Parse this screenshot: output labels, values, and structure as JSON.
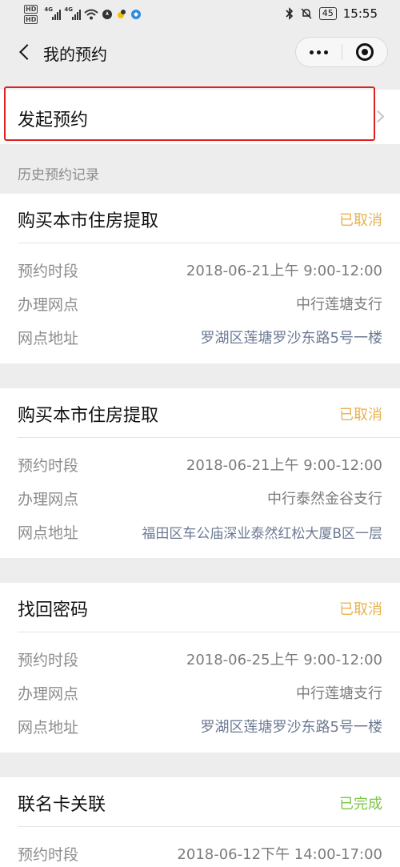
{
  "status_bar": {
    "left_icons": [
      "hd-icon",
      "signal-4g-icon",
      "signal-4g-icon",
      "wifi-icon",
      "compass-icon",
      "bird-icon",
      "app-icon"
    ],
    "hd": "HD",
    "net_1": "4G",
    "net_2": "4G",
    "battery": "45",
    "time": "15:55"
  },
  "nav": {
    "title": "我的预约"
  },
  "launch": {
    "label": "发起预约"
  },
  "history": {
    "header": "历史预约记录"
  },
  "records": [
    {
      "title": "购买本市住房提取",
      "status": "已取消",
      "rows": [
        {
          "label": "预约时段",
          "value": "2018-06-21上午 9:00-12:00"
        },
        {
          "label": "办理网点",
          "value": "中行莲塘支行"
        },
        {
          "label": "网点地址",
          "value": "罗湖区莲塘罗沙东路5号一楼"
        }
      ]
    },
    {
      "title": "购买本市住房提取",
      "status": "已取消",
      "rows": [
        {
          "label": "预约时段",
          "value": "2018-06-21上午 9:00-12:00"
        },
        {
          "label": "办理网点",
          "value": "中行泰然金谷支行"
        },
        {
          "label": "网点地址",
          "value": "福田区车公庙深业泰然红松大厦B区一层"
        }
      ]
    },
    {
      "title": "找回密码",
      "status": "已取消",
      "rows": [
        {
          "label": "预约时段",
          "value": "2018-06-25上午 9:00-12:00"
        },
        {
          "label": "办理网点",
          "value": "中行莲塘支行"
        },
        {
          "label": "网点地址",
          "value": "罗湖区莲塘罗沙东路5号一楼"
        }
      ]
    },
    {
      "title": "联名卡关联",
      "status": "已完成",
      "rows": [
        {
          "label": "预约时段",
          "value": "2018-06-12下午 14:00-17:00"
        }
      ]
    }
  ],
  "colors": {
    "cancelled": "#e8b24e",
    "completed": "#7cc544",
    "highlight": "#e02020"
  }
}
